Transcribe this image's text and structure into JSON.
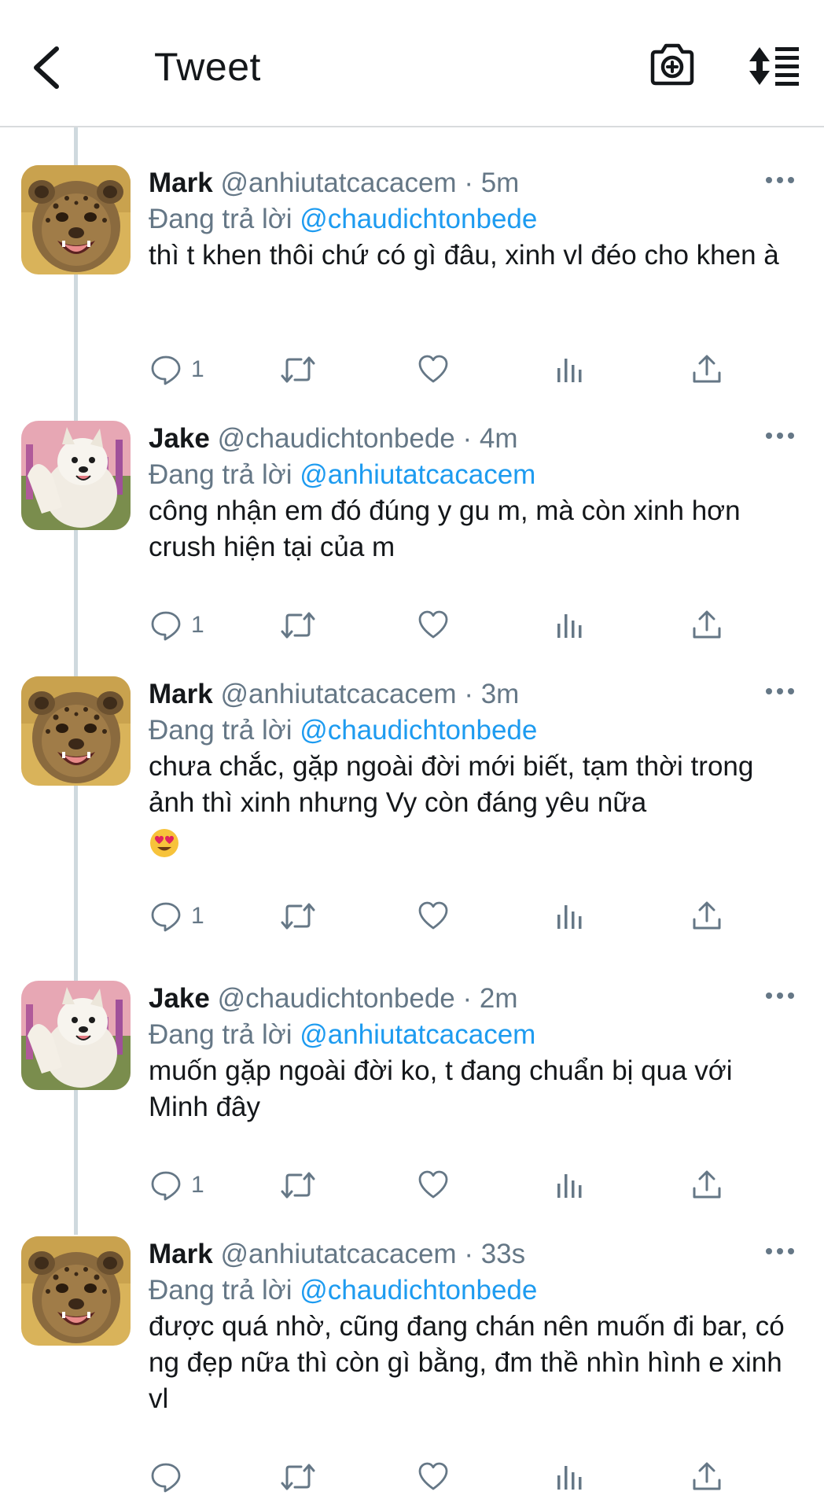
{
  "header": {
    "title": "Tweet",
    "icons": {
      "back": "chevron-left-icon",
      "camera": "camera-plus-icon",
      "sort": "sort-icon"
    }
  },
  "colors": {
    "link": "#1d9bf0",
    "muted": "#657786",
    "text": "#14171a",
    "divider": "#d8dbdd"
  },
  "reply_prefix": "Đang trả lời",
  "tweets": [
    {
      "name": "Mark",
      "handle": "@anhiutatcacacem",
      "sep": "·",
      "time": "5m",
      "reply_to": "@chaudichtonbede",
      "text": "thì t khen thôi chứ có gì đâu, xinh vl đéo cho khen à",
      "reply_count": "1",
      "avatar": "cheetah-cub-avatar"
    },
    {
      "name": "Jake",
      "handle": "@chaudichtonbede",
      "sep": "·",
      "time": "4m",
      "reply_to": "@anhiutatcacacem",
      "text": "công nhận em đó đúng y gu m, mà còn xinh hơn crush hiện tại của m",
      "reply_count": "1",
      "avatar": "samoyed-dog-avatar"
    },
    {
      "name": "Mark",
      "handle": "@anhiutatcacacem",
      "sep": "·",
      "time": "3m",
      "reply_to": "@chaudichtonbede",
      "text": "chưa chắc, gặp ngoài đời mới biết, tạm thời trong ảnh thì xinh nhưng Vy còn đáng yêu nữa",
      "emoji": "heart-eyes-emoji",
      "reply_count": "1",
      "avatar": "cheetah-cub-avatar"
    },
    {
      "name": "Jake",
      "handle": "@chaudichtonbede",
      "sep": "·",
      "time": "2m",
      "reply_to": "@anhiutatcacacem",
      "text": "muốn gặp ngoài đời ko, t đang chuẩn bị qua với Minh đây",
      "reply_count": "1",
      "avatar": "samoyed-dog-avatar"
    },
    {
      "name": "Mark",
      "handle": "@anhiutatcacacem",
      "sep": "·",
      "time": "33s",
      "reply_to": "@chaudichtonbede",
      "text": "được quá nhờ, cũng đang chán nên muốn đi bar, có ng đẹp nữa thì còn gì bằng, đm thề nhìn hình e xinh vl",
      "reply_count": "",
      "avatar": "cheetah-cub-avatar"
    }
  ]
}
